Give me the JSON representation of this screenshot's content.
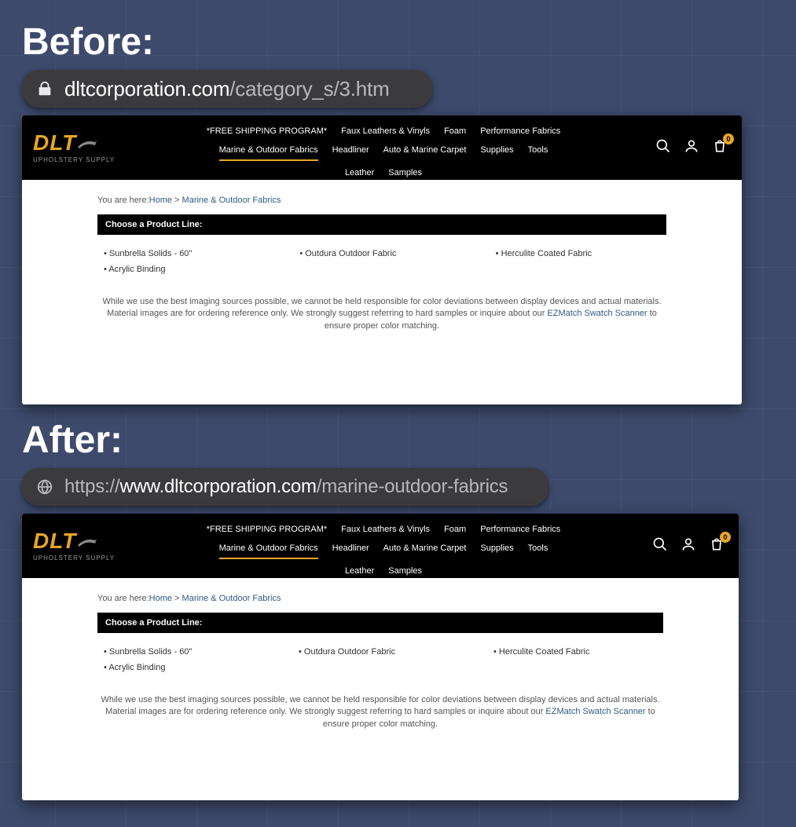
{
  "labels": {
    "before": "Before:",
    "after": "After:"
  },
  "before": {
    "url_host": "dltcorporation.com",
    "url_path": "/category_s/3.htm"
  },
  "after": {
    "url_proto": "https://",
    "url_host": "www.dltcorporation.com",
    "url_path": "/marine-outdoor-fabrics"
  },
  "site": {
    "logo_main": "DLT",
    "logo_sub": "UPHOLSTERY SUPPLY",
    "nav_row1": [
      "*FREE SHIPPING PROGRAM*",
      "Faux Leathers & Vinyls",
      "Foam",
      "Performance Fabrics"
    ],
    "nav_row2": [
      "Marine & Outdoor Fabrics",
      "Headliner",
      "Auto & Marine Carpet",
      "Supplies",
      "Tools"
    ],
    "nav_row3": [
      "Leather",
      "Samples"
    ],
    "nav_active": "Marine & Outdoor Fabrics",
    "cart_count": "0",
    "breadcrumb_prefix": "You are here:",
    "breadcrumb_home": "Home",
    "breadcrumb_sep": " > ",
    "breadcrumb_current": "Marine & Outdoor Fabrics",
    "choose_label": "Choose a Product Line:",
    "products_col1": [
      "Sunbrella Solids - 60\"",
      "Acrylic Binding"
    ],
    "products_col2": [
      "Outdura Outdoor Fabric"
    ],
    "products_col3": [
      "Herculite Coated Fabric"
    ],
    "disclaimer_a": "While we use the best imaging sources possible, we cannot be held responsible for color deviations between display devices and actual materials. Material images are for ordering reference only. We strongly suggest referring to hard samples or inquire about our ",
    "disclaimer_link": "EZMatch Swatch Scanner",
    "disclaimer_b": " to ensure proper color matching."
  }
}
